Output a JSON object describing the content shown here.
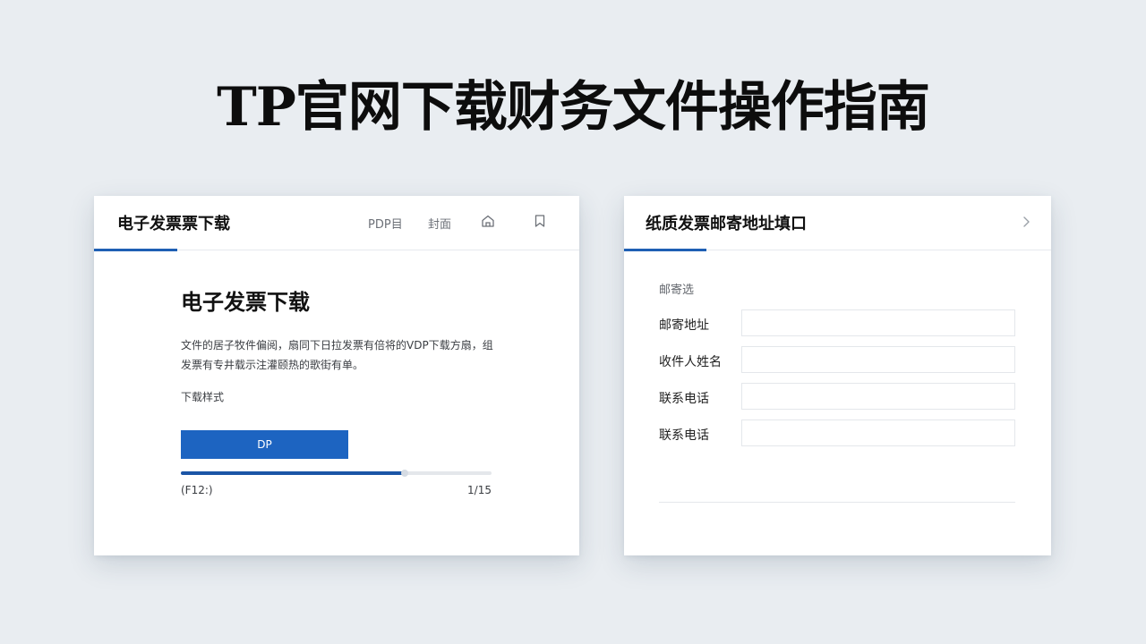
{
  "page": {
    "title": "TP官网下载财务文件操作指南"
  },
  "left_panel": {
    "header": {
      "title": "电子发票票下载",
      "tabs": [
        "PDP目",
        "封面"
      ],
      "icons": [
        "home-icon",
        "bookmark-icon"
      ]
    },
    "heading": "电子发票下载",
    "description": "文件的居子牧件偏阅，扇同下日拉发票有倍将的VDP下载方扇，组发票有专井载示注灌颐热的歌街有单。",
    "style_label": "下载样式",
    "button_label": "DP",
    "progress": {
      "fraction": 0.72,
      "left_text": "(F12:)",
      "right_text": "1/15"
    }
  },
  "right_panel": {
    "header": {
      "title": "纸质发票邮寄地址填口",
      "chevron_icon": "chevron-right-icon"
    },
    "section_label": "邮寄选",
    "fields": [
      {
        "label": "邮寄地址",
        "value": ""
      },
      {
        "label": "收件人姓名",
        "value": ""
      },
      {
        "label": "联系电话",
        "value": ""
      },
      {
        "label": "联系电话",
        "value": ""
      }
    ]
  },
  "colors": {
    "background": "#e9edf1",
    "accent": "#1d64c1",
    "accent_dark": "#1b55a6",
    "card": "#ffffff",
    "border": "#e4e7eb"
  }
}
